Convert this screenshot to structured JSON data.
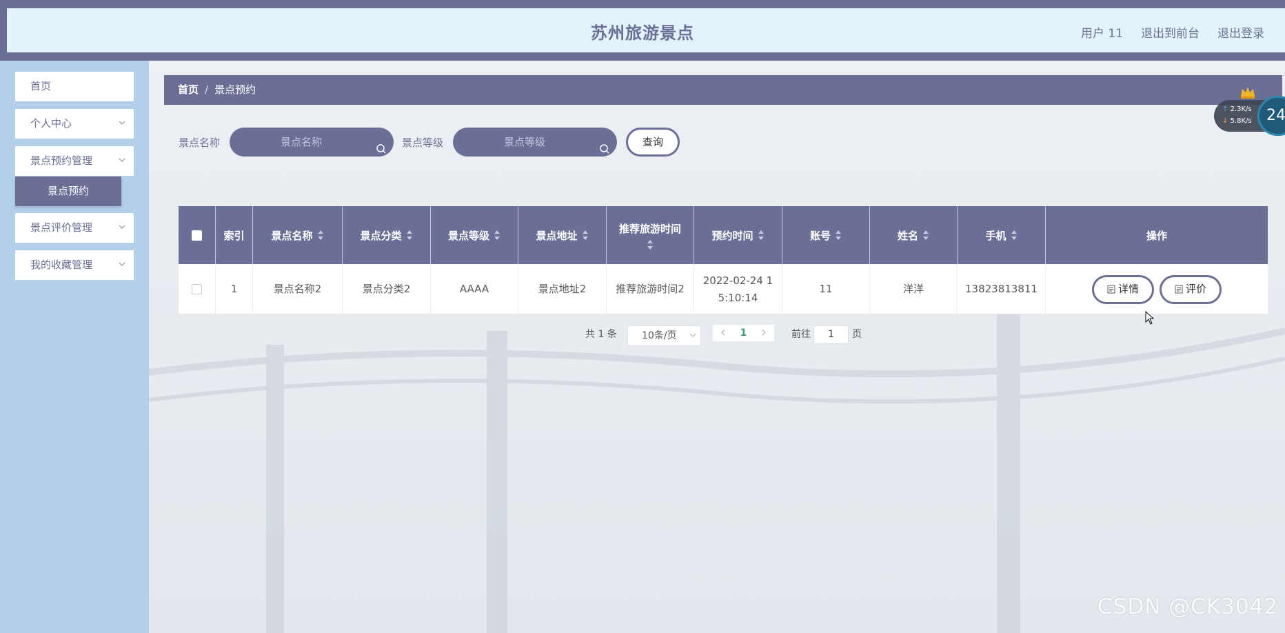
{
  "header": {
    "title": "苏州旅游景点",
    "user": "用户 11",
    "to_front": "退出到前台",
    "logout": "退出登录"
  },
  "sidebar": {
    "items": [
      {
        "label": "首页"
      },
      {
        "label": "个人中心"
      },
      {
        "label": "景点预约管理"
      },
      {
        "label": "景点评价管理"
      },
      {
        "label": "我的收藏管理"
      }
    ],
    "active_sub": "景点预约"
  },
  "breadcrumb": {
    "home": "首页",
    "sep": "/",
    "current": "景点预约"
  },
  "search": {
    "name_label": "景点名称",
    "name_placeholder": "景点名称",
    "level_label": "景点等级",
    "level_placeholder": "景点等级",
    "query_button": "查询"
  },
  "table": {
    "headers": [
      "索引",
      "景点名称",
      "景点分类",
      "景点等级",
      "景点地址",
      "推荐旅游时间",
      "预约时间",
      "账号",
      "姓名",
      "手机",
      "操作"
    ],
    "rows": [
      {
        "index": "1",
        "name": "景点名称2",
        "category": "景点分类2",
        "level": "AAAA",
        "address": "景点地址2",
        "recommend_time": "推荐旅游时间2",
        "book_time_1": "2022-02-24 1",
        "book_time_2": "5:10:14",
        "account": "11",
        "person": "洋洋",
        "phone": "13823813811",
        "detail_btn": "详情",
        "review_btn": "评价"
      }
    ]
  },
  "pagination": {
    "total": "共 1 条",
    "page_size": "10条/页",
    "current_page": "1",
    "goto_label": "前往",
    "goto_value": "1",
    "page_unit": "页"
  },
  "net_widget": {
    "up": "2.3K/s",
    "down": "5.8K/s",
    "badge": "24"
  },
  "watermark": "CSDN @CK3042",
  "colors": {
    "primary": "#6b6f96",
    "header_bg": "#e3f3fc",
    "sidebar_bg": "#b4cfe9"
  }
}
